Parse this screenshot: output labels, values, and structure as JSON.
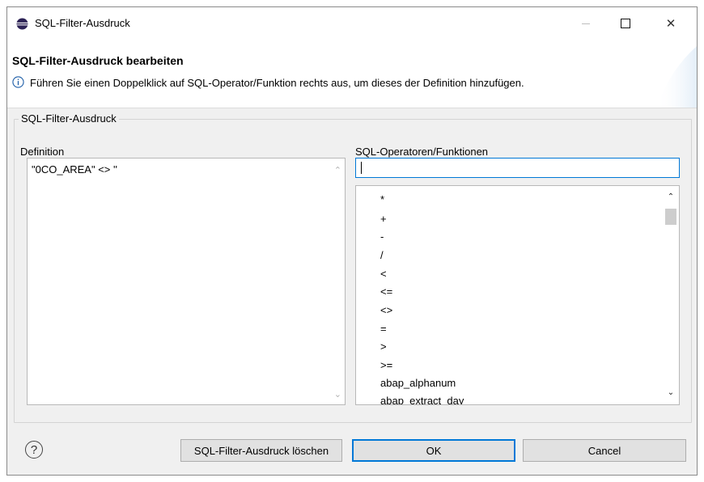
{
  "window": {
    "title": "SQL-Filter-Ausdruck",
    "minimize_icon": "minimize-icon",
    "maximize_icon": "maximize-icon",
    "close_icon": "close-icon",
    "close_glyph": "✕"
  },
  "header": {
    "title": "SQL-Filter-Ausdruck bearbeiten",
    "info_icon": "info-icon",
    "message": "Führen Sie einen Doppelklick auf SQL-Operator/Funktion rechts aus, um dieses der Definition hinzufügen."
  },
  "group": {
    "legend": "SQL-Filter-Ausdruck",
    "definition_label": "Definition",
    "definition_value": "\"0CO_AREA\" <> ''",
    "operators_label": "SQL-Operatoren/Funktionen",
    "search_value": "",
    "operators": [
      "*",
      "+",
      "-",
      "/",
      "<",
      "<=",
      "<>",
      "=",
      ">",
      ">=",
      "abap_alphanum",
      "abap_extract_day"
    ]
  },
  "footer": {
    "help_icon": "help-icon",
    "help_glyph": "?",
    "clear_label": "SQL-Filter-Ausdruck löschen",
    "ok_label": "OK",
    "cancel_label": "Cancel"
  },
  "colors": {
    "accent": "#0078d7",
    "dialog_bg": "#f0f0f0",
    "button_bg": "#e1e1e1"
  }
}
